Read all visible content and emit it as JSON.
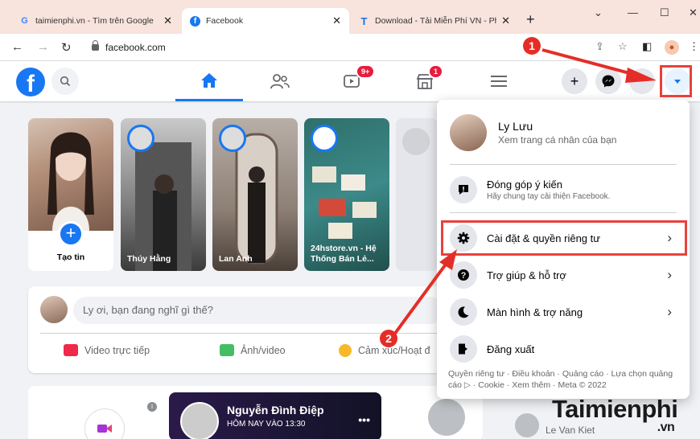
{
  "browser": {
    "tabs": [
      {
        "title": "taimienphi.vn - Tìm trên Google",
        "favicon": "G",
        "color": "#4285f4"
      },
      {
        "title": "Facebook",
        "favicon": "f",
        "color": "#1877f2"
      },
      {
        "title": "Download - Tải Miễn Phí VN - Ph",
        "favicon": "T",
        "color": "#1a73e8"
      }
    ],
    "url": "facebook.com"
  },
  "facebook": {
    "notification_badges": {
      "watch": "9+",
      "marketplace": "1"
    },
    "stories": [
      {
        "label": "Tạo tin"
      },
      {
        "label": "Thúy Hằng"
      },
      {
        "label": "Lan Anh"
      },
      {
        "label": "24hstore.vn - Hệ Thống Bán Lẻ..."
      }
    ],
    "composer": {
      "placeholder": "Ly ơi, bạn đang nghĩ gì thế?",
      "actions": [
        "Video trực tiếp",
        "Ảnh/video",
        "Cảm xúc/Hoạt đ"
      ]
    },
    "live": {
      "name": "Nguyễn Đình Điệp",
      "time": "HÔM NAY VÀO 13:30"
    },
    "partial_contact": "Le Van Kiet"
  },
  "menu": {
    "profile": {
      "name": "Ly Lưu",
      "subtitle": "Xem trang cá nhân của bạn"
    },
    "feedback": {
      "label": "Đóng góp ý kiến",
      "sub": "Hãy chung tay cải thiện Facebook."
    },
    "items": [
      {
        "label": "Cài đặt & quyền riêng tư",
        "icon": "gear-icon"
      },
      {
        "label": "Trợ giúp & hỗ trợ",
        "icon": "help-icon"
      },
      {
        "label": "Màn hình & trợ năng",
        "icon": "moon-icon"
      },
      {
        "label": "Đăng xuất",
        "icon": "logout-icon"
      }
    ],
    "footer": "Quyền riêng tư · Điều khoản · Quảng cáo · Lựa chọn quảng cáo ▷ · Cookie · Xem thêm · Meta © 2022"
  },
  "annotations": {
    "step1": "1",
    "step2": "2",
    "color": "#e52d27"
  },
  "watermark": {
    "main": "Taimienphi",
    "sub": ".vn"
  }
}
